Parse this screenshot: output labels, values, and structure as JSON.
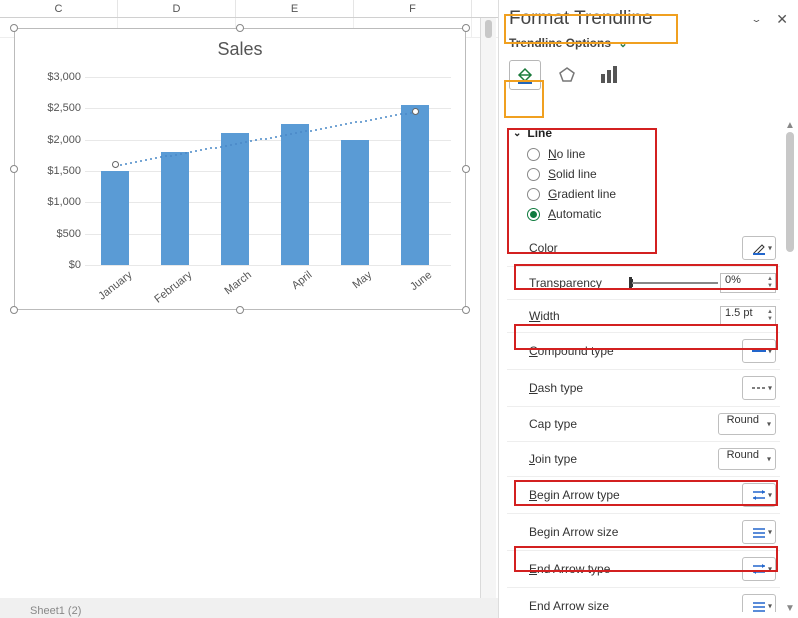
{
  "columns": [
    "C",
    "D",
    "E",
    "F"
  ],
  "chart_data": {
    "type": "bar",
    "title": "Sales",
    "categories": [
      "January",
      "February",
      "March",
      "April",
      "May",
      "June"
    ],
    "values": [
      1500,
      1800,
      2100,
      2250,
      2000,
      2550
    ],
    "ylabel": "",
    "xlabel": "",
    "ylim": [
      0,
      3000
    ],
    "y_ticks": [
      "$3,000",
      "$2,500",
      "$2,000",
      "$1,500",
      "$1,000",
      "$500",
      "$0"
    ],
    "trendline": {
      "type": "linear",
      "selected": true
    }
  },
  "sheet_tab": "Sheet1 (2)",
  "panel": {
    "title": "Format Trendline",
    "subtitle": "Trendline Options",
    "line_section": "Line",
    "line_options": {
      "no_line_u": "N",
      "no_line_rest": "o line",
      "solid_u": "S",
      "solid_rest": "olid line",
      "gradient_u": "G",
      "gradient_rest": "radient line",
      "auto_u": "A",
      "auto_rest": "utomatic",
      "selected": "automatic"
    },
    "props": {
      "color": {
        "u": "C",
        "rest": "olor"
      },
      "transparency": {
        "u": "T",
        "rest": "ransparency",
        "value": "0%"
      },
      "width": {
        "u": "W",
        "rest": "idth",
        "value": "1.5 pt"
      },
      "compound": {
        "u": "C",
        "rest": "ompound type"
      },
      "dash": {
        "u": "D",
        "rest": "ash type"
      },
      "cap": {
        "u": "",
        "rest": "Cap type",
        "value": "Round"
      },
      "join": {
        "u": "J",
        "rest": "oin type",
        "value": "Round"
      },
      "begin_arrow_type": {
        "u": "B",
        "rest": "egin Arrow type"
      },
      "begin_arrow_size": {
        "u": "",
        "rest": "Begin Arrow size"
      },
      "end_arrow_type": {
        "u": "E",
        "rest": "nd Arrow type"
      },
      "end_arrow_size": {
        "u": "",
        "rest": "End Arrow size"
      }
    }
  }
}
